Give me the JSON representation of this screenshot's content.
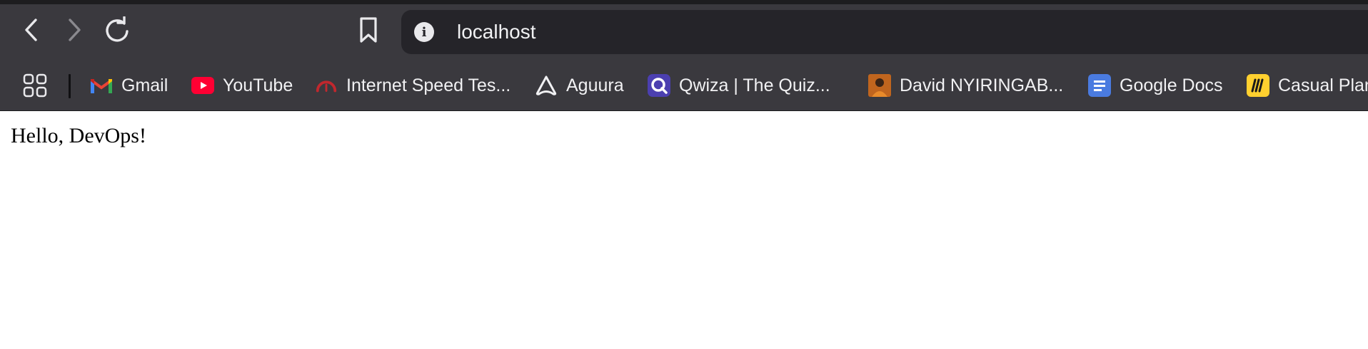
{
  "browser": {
    "address": "localhost",
    "colors": {
      "chrome_bg": "#3a393e",
      "address_bg": "#252429",
      "text": "#f1f1f3"
    },
    "toolbar": {
      "back_icon": "chevron-left-icon",
      "forward_icon": "chevron-right-icon",
      "reload_icon": "reload-icon",
      "bookmark_icon": "bookmark-icon",
      "info_icon": "info-icon"
    },
    "bookmarks": [
      {
        "label": "Gmail",
        "icon": "gmail-icon"
      },
      {
        "label": "YouTube",
        "icon": "youtube-icon"
      },
      {
        "label": "Internet Speed Tes...",
        "icon": "speedometer-icon"
      },
      {
        "label": "Aguura",
        "icon": "aguura-icon"
      },
      {
        "label": "Qwiza | The Quiz...",
        "icon": "qwiza-icon"
      },
      {
        "label": "David NYIRINGAB...",
        "icon": "avatar-icon"
      },
      {
        "label": "Google Docs",
        "icon": "google-docs-icon"
      },
      {
        "label": "Casual Plan",
        "icon": "miro-icon"
      }
    ]
  },
  "page": {
    "text": "Hello, DevOps!"
  }
}
